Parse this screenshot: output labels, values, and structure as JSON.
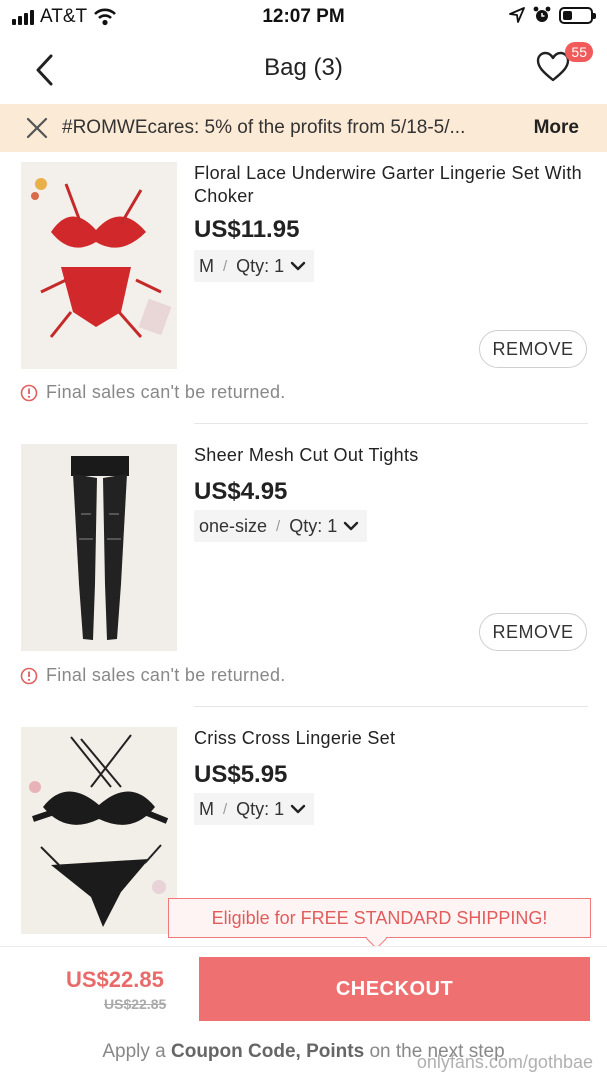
{
  "status_bar": {
    "carrier": "AT&T",
    "time": "12:07 PM",
    "battery_level": 0.35
  },
  "nav": {
    "title": "Bag (3)",
    "wishlist_count": "55"
  },
  "banner": {
    "text": "#ROMWEcares: 5% of the profits from 5/18-5/...",
    "more_label": "More"
  },
  "items": [
    {
      "title": "Floral Lace Underwire Garter Lingerie Set With Choker",
      "price": "US$11.95",
      "size": "M",
      "qty_label": "Qty: 1",
      "remove_label": "REMOVE",
      "note": "Final sales can't be returned."
    },
    {
      "title": "Sheer Mesh Cut Out Tights",
      "price": "US$4.95",
      "size": "one-size",
      "qty_label": "Qty: 1",
      "remove_label": "REMOVE",
      "note": "Final sales can't be returned."
    },
    {
      "title": "Criss Cross Lingerie Set",
      "price": "US$5.95",
      "size": "M",
      "qty_label": "Qty: 1"
    }
  ],
  "shipping_tip": "Eligible for FREE STANDARD SHIPPING!",
  "summary": {
    "total": "US$22.85",
    "original_total": "US$22.85",
    "checkout_label": "CHECKOUT",
    "coupon_prefix": "Apply a",
    "coupon_bold": "Coupon Code, Points",
    "coupon_suffix": "on the next step"
  },
  "watermark": "onlyfans.com/gothbae",
  "colors": {
    "accent": "#ef7070",
    "banner_bg": "#fbead6",
    "badge": "#f05a5a"
  }
}
